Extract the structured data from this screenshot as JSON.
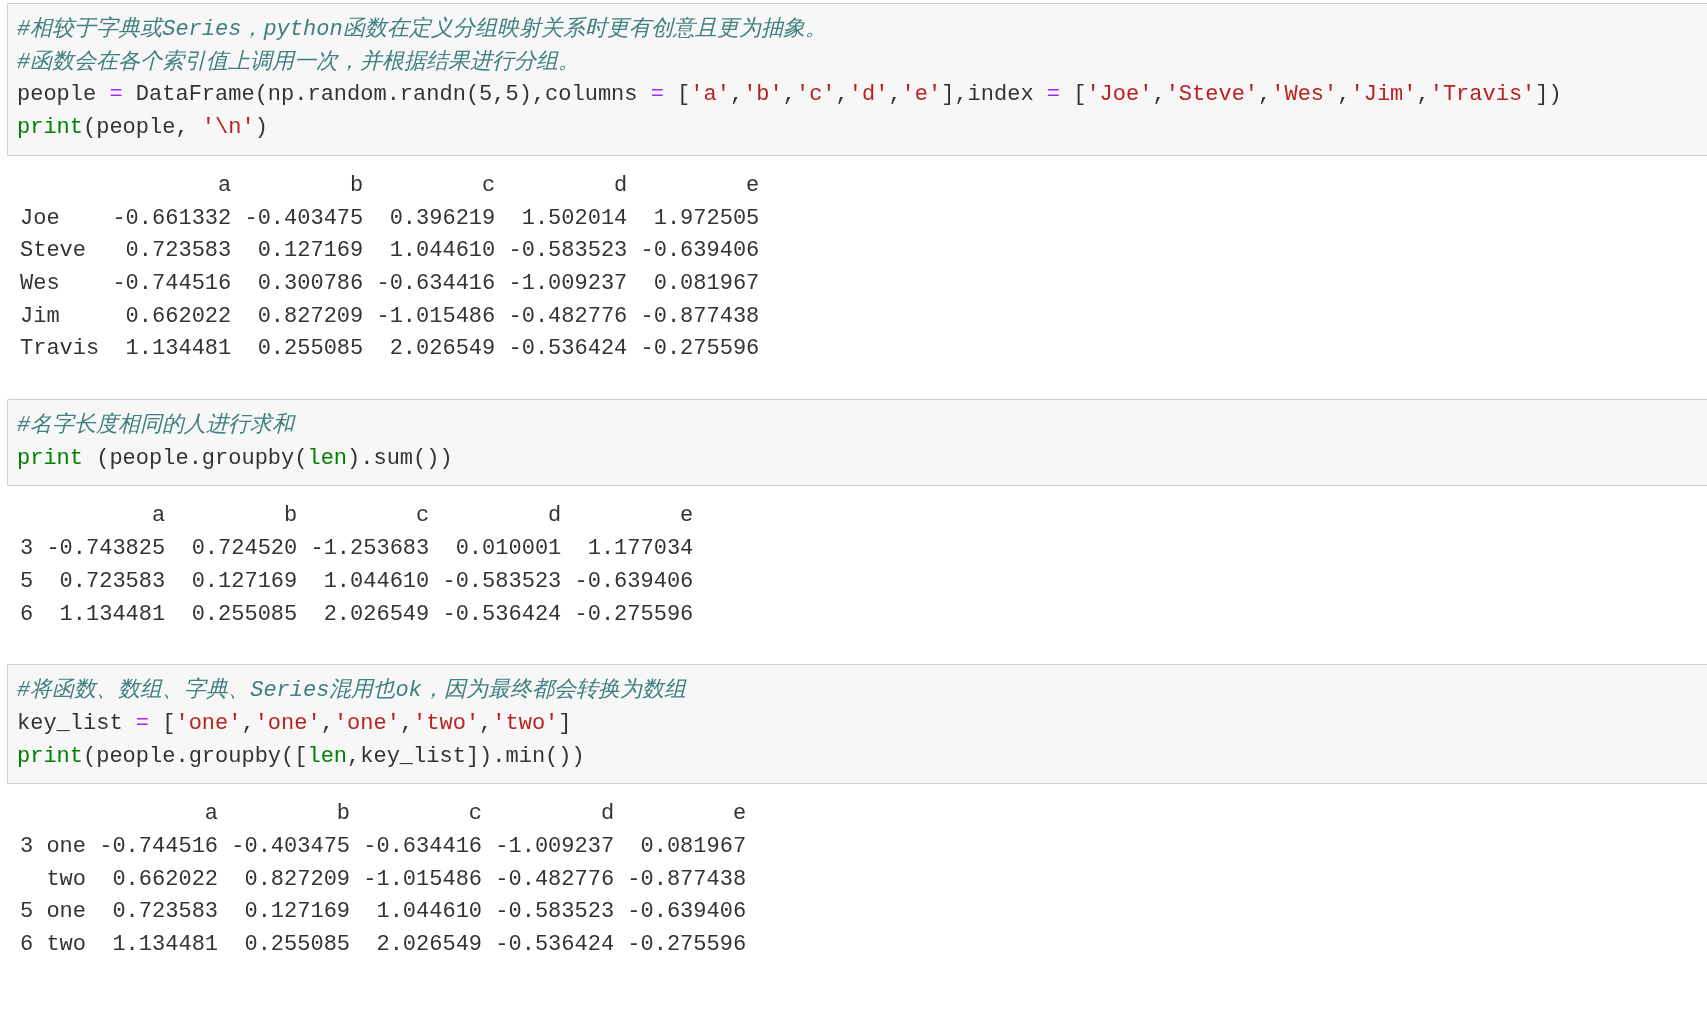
{
  "cells": [
    {
      "code": [
        [
          {
            "kind": "comment",
            "text": "#相较于字典或Series，python函数在定义分组映射关系时更有创意且更为抽象。"
          }
        ],
        [
          {
            "kind": "comment",
            "text": "#函数会在各个索引值上调用一次，并根据结果进行分组。"
          }
        ],
        [
          {
            "kind": "name",
            "text": "people "
          },
          {
            "kind": "operator",
            "text": "="
          },
          {
            "kind": "name",
            "text": " DataFrame(np.random.randn(5,5),columns "
          },
          {
            "kind": "operator",
            "text": "="
          },
          {
            "kind": "name",
            "text": " ["
          },
          {
            "kind": "string",
            "text": "'a'"
          },
          {
            "kind": "name",
            "text": ","
          },
          {
            "kind": "string",
            "text": "'b'"
          },
          {
            "kind": "name",
            "text": ","
          },
          {
            "kind": "string",
            "text": "'c'"
          },
          {
            "kind": "name",
            "text": ","
          },
          {
            "kind": "string",
            "text": "'d'"
          },
          {
            "kind": "name",
            "text": ","
          },
          {
            "kind": "string",
            "text": "'e'"
          },
          {
            "kind": "name",
            "text": "],index "
          },
          {
            "kind": "operator",
            "text": "="
          },
          {
            "kind": "name",
            "text": " ["
          },
          {
            "kind": "string",
            "text": "'Joe'"
          },
          {
            "kind": "name",
            "text": ","
          },
          {
            "kind": "string",
            "text": "'Steve'"
          },
          {
            "kind": "name",
            "text": ","
          },
          {
            "kind": "string",
            "text": "'Wes'"
          },
          {
            "kind": "name",
            "text": ","
          },
          {
            "kind": "string",
            "text": "'Jim'"
          },
          {
            "kind": "name",
            "text": ","
          },
          {
            "kind": "string",
            "text": "'Travis'"
          },
          {
            "kind": "name",
            "text": "])"
          }
        ],
        [
          {
            "kind": "builtin",
            "text": "print"
          },
          {
            "kind": "name",
            "text": "(people, "
          },
          {
            "kind": "string",
            "text": "'\\n'"
          },
          {
            "kind": "name",
            "text": ")"
          }
        ]
      ],
      "output": [
        "               a         b         c         d         e",
        "Joe    -0.661332 -0.403475  0.396219  1.502014  1.972505",
        "Steve   0.723583  0.127169  1.044610 -0.583523 -0.639406",
        "Wes    -0.744516  0.300786 -0.634416 -1.009237  0.081967",
        "Jim     0.662022  0.827209 -1.015486 -0.482776 -0.877438",
        "Travis  1.134481  0.255085  2.026549 -0.536424 -0.275596"
      ]
    },
    {
      "code": [
        [
          {
            "kind": "comment",
            "text": "#名字长度相同的人进行求和"
          }
        ],
        [
          {
            "kind": "builtin",
            "text": "print"
          },
          {
            "kind": "name",
            "text": " (people.groupby("
          },
          {
            "kind": "builtin",
            "text": "len"
          },
          {
            "kind": "name",
            "text": ").sum())"
          }
        ]
      ],
      "output": [
        "          a         b         c         d         e",
        "3 -0.743825  0.724520 -1.253683  0.010001  1.177034",
        "5  0.723583  0.127169  1.044610 -0.583523 -0.639406",
        "6  1.134481  0.255085  2.026549 -0.536424 -0.275596"
      ]
    },
    {
      "code": [
        [
          {
            "kind": "comment",
            "text": "#将函数、数组、字典、Series混用也ok，因为最终都会转换为数组"
          }
        ],
        [
          {
            "kind": "name",
            "text": "key_list "
          },
          {
            "kind": "operator",
            "text": "="
          },
          {
            "kind": "name",
            "text": " ["
          },
          {
            "kind": "string",
            "text": "'one'"
          },
          {
            "kind": "name",
            "text": ","
          },
          {
            "kind": "string",
            "text": "'one'"
          },
          {
            "kind": "name",
            "text": ","
          },
          {
            "kind": "string",
            "text": "'one'"
          },
          {
            "kind": "name",
            "text": ","
          },
          {
            "kind": "string",
            "text": "'two'"
          },
          {
            "kind": "name",
            "text": ","
          },
          {
            "kind": "string",
            "text": "'two'"
          },
          {
            "kind": "name",
            "text": "]"
          }
        ],
        [
          {
            "kind": "builtin",
            "text": "print"
          },
          {
            "kind": "name",
            "text": "(people.groupby(["
          },
          {
            "kind": "builtin",
            "text": "len"
          },
          {
            "kind": "name",
            "text": ",key_list]).min())"
          }
        ]
      ],
      "output": [
        "              a         b         c         d         e",
        "3 one -0.744516 -0.403475 -0.634416 -1.009237  0.081967",
        "  two  0.662022  0.827209 -1.015486 -0.482776 -0.877438",
        "5 one  0.723583  0.127169  1.044610 -0.583523 -0.639406",
        "6 two  1.134481  0.255085  2.026549 -0.536424 -0.275596"
      ]
    }
  ]
}
